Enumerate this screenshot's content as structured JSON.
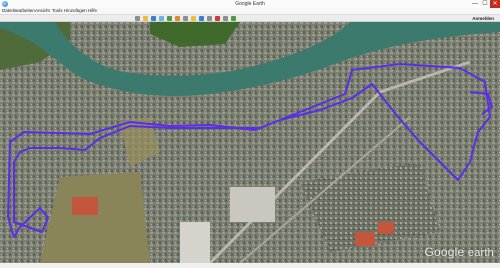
{
  "window": {
    "title": "Google Earth",
    "minimize": "—",
    "maximize": "☐",
    "close": "✕"
  },
  "menu": {
    "items": [
      "Datei",
      "Bearbeiten",
      "Ansicht",
      "Tools",
      "Hinzufügen",
      "Hilfe"
    ]
  },
  "toolbar": {
    "signin_label": "Anmelden"
  },
  "map": {
    "logo_google": "Google",
    "logo_earth": "earth",
    "route_color": "#5a2ee8",
    "river_color": "#3d7a6e"
  }
}
